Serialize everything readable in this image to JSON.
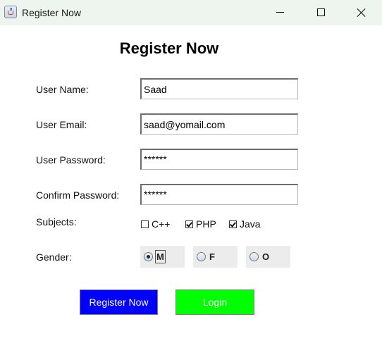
{
  "window": {
    "title": "Register Now",
    "icon": "java-cup-icon"
  },
  "form": {
    "heading": "Register Now",
    "fields": {
      "username": {
        "label": "User Name:",
        "value": "Saad"
      },
      "email": {
        "label": "User Email:",
        "value": "saad@yomail.com"
      },
      "password": {
        "label": "User Password:",
        "value": "******"
      },
      "confirm_password": {
        "label": "Confirm Password:",
        "value": "******"
      }
    },
    "subjects": {
      "label": "Subjects:",
      "options": [
        {
          "label": "C++",
          "checked": false
        },
        {
          "label": "PHP",
          "checked": true
        },
        {
          "label": "Java",
          "checked": true
        }
      ]
    },
    "gender": {
      "label": "Gender:",
      "options": [
        {
          "label": "M",
          "selected": true
        },
        {
          "label": "F",
          "selected": false
        },
        {
          "label": "O",
          "selected": false
        }
      ]
    },
    "buttons": {
      "register": {
        "label": "Register Now",
        "color": "#0000ff"
      },
      "login": {
        "label": "Login",
        "color": "#00ff00"
      }
    }
  }
}
